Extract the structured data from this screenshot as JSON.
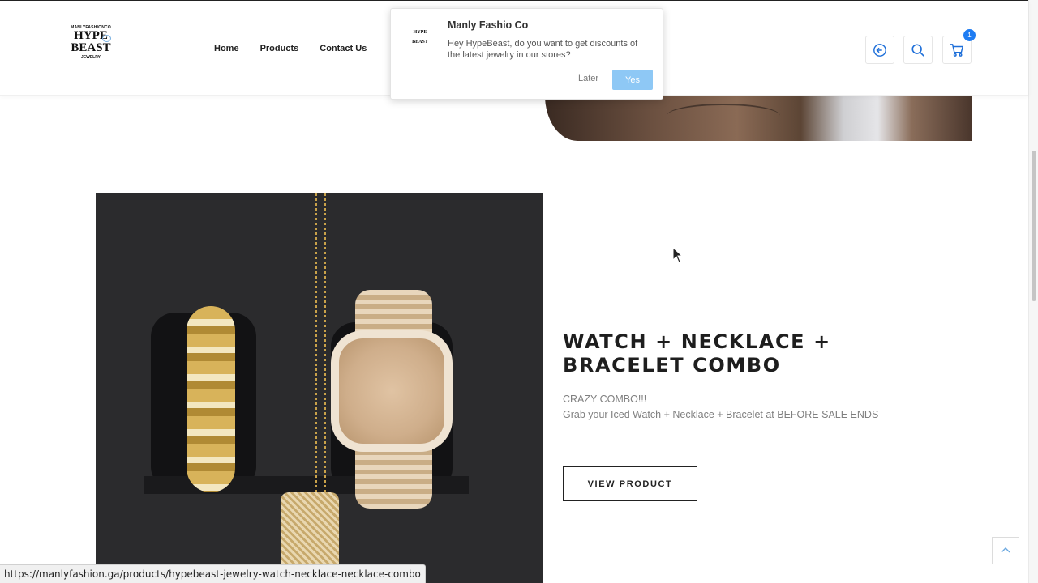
{
  "brand": {
    "logo_top": "MANLYFASHIONCO",
    "logo_mid_1": "HYPE",
    "logo_mid_2": "BEAST",
    "logo_bottom": "JEWELRY"
  },
  "nav": {
    "items": [
      {
        "label": "Home"
      },
      {
        "label": "Products"
      },
      {
        "label": "Contact Us"
      }
    ]
  },
  "header_icons": {
    "login_icon": "arrow-circle-left-icon",
    "search_icon": "search-icon",
    "cart_icon": "cart-icon",
    "cart_count": "1",
    "badge_color": "#1e7cf2"
  },
  "popup": {
    "title": "Manly Fashio Co",
    "message": "Hey HypeBeast, do you want to get discounts of the latest jewelry in our stores?",
    "later_label": "Later",
    "yes_label": "Yes",
    "yes_color": "#8ec8f5"
  },
  "product": {
    "title": "WATCH + NECKLACE + BRACELET COMBO",
    "desc_line1": "CRAZY COMBO!!!",
    "desc_line2": "Grab your Iced Watch + Necklace + Bracelet at BEFORE SALE ENDS",
    "button_label": "VIEW PRODUCT"
  },
  "status_bar": {
    "url": "https://manlyfashion.ga/products/hypebeast-jewelry-watch-necklace-necklace-combo"
  }
}
